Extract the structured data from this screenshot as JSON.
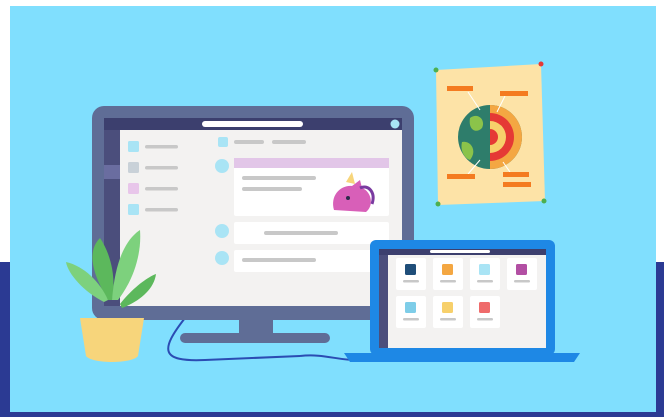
{
  "colors": {
    "page_background": "#ffffff",
    "band": "#2b3a93",
    "sky": "#80dffe",
    "monitor_frame": "#5f6d96",
    "monitor_titlebar": "#3c3f6e",
    "monitor_rail": "#4b4e7c",
    "screen_white": "#ffffff",
    "sidebar": "#f3f2f1",
    "chat_bg": "#f3f2f1",
    "highlight_bar": "#e2c6e8",
    "placeholder_line": "#c8c8c8",
    "avatar_blue": "#a9e4f5",
    "laptop_blue": "#1e88e5",
    "laptop_screen_bg": "#f3f2f1",
    "poster": "#fde3a7",
    "poster_label": "#f47b20",
    "plant_pot": "#f7d57b",
    "plant_leaf": "#5cb85c",
    "plant_leaf_light": "#7dd17d",
    "cable": "#2b4cb3",
    "unicorn": "#d85fb8"
  },
  "icons": {
    "monitor": "desktop-monitor-icon",
    "laptop": "laptop-icon",
    "poster": "earth-layers-poster-icon",
    "plant": "potted-plant-icon",
    "mascot": "unicorn-mascot-icon"
  },
  "sidebar_item_colors": [
    "#a9e4f5",
    "#c9d1d8",
    "#e8c6ea",
    "#a9e4f5"
  ],
  "laptop_tile_colors": [
    "#1f4e79",
    "#f4a742",
    "#a9e4f5",
    "#b24fa3",
    "#7ecde8",
    "#f7d06b",
    "#ef6b6b"
  ]
}
